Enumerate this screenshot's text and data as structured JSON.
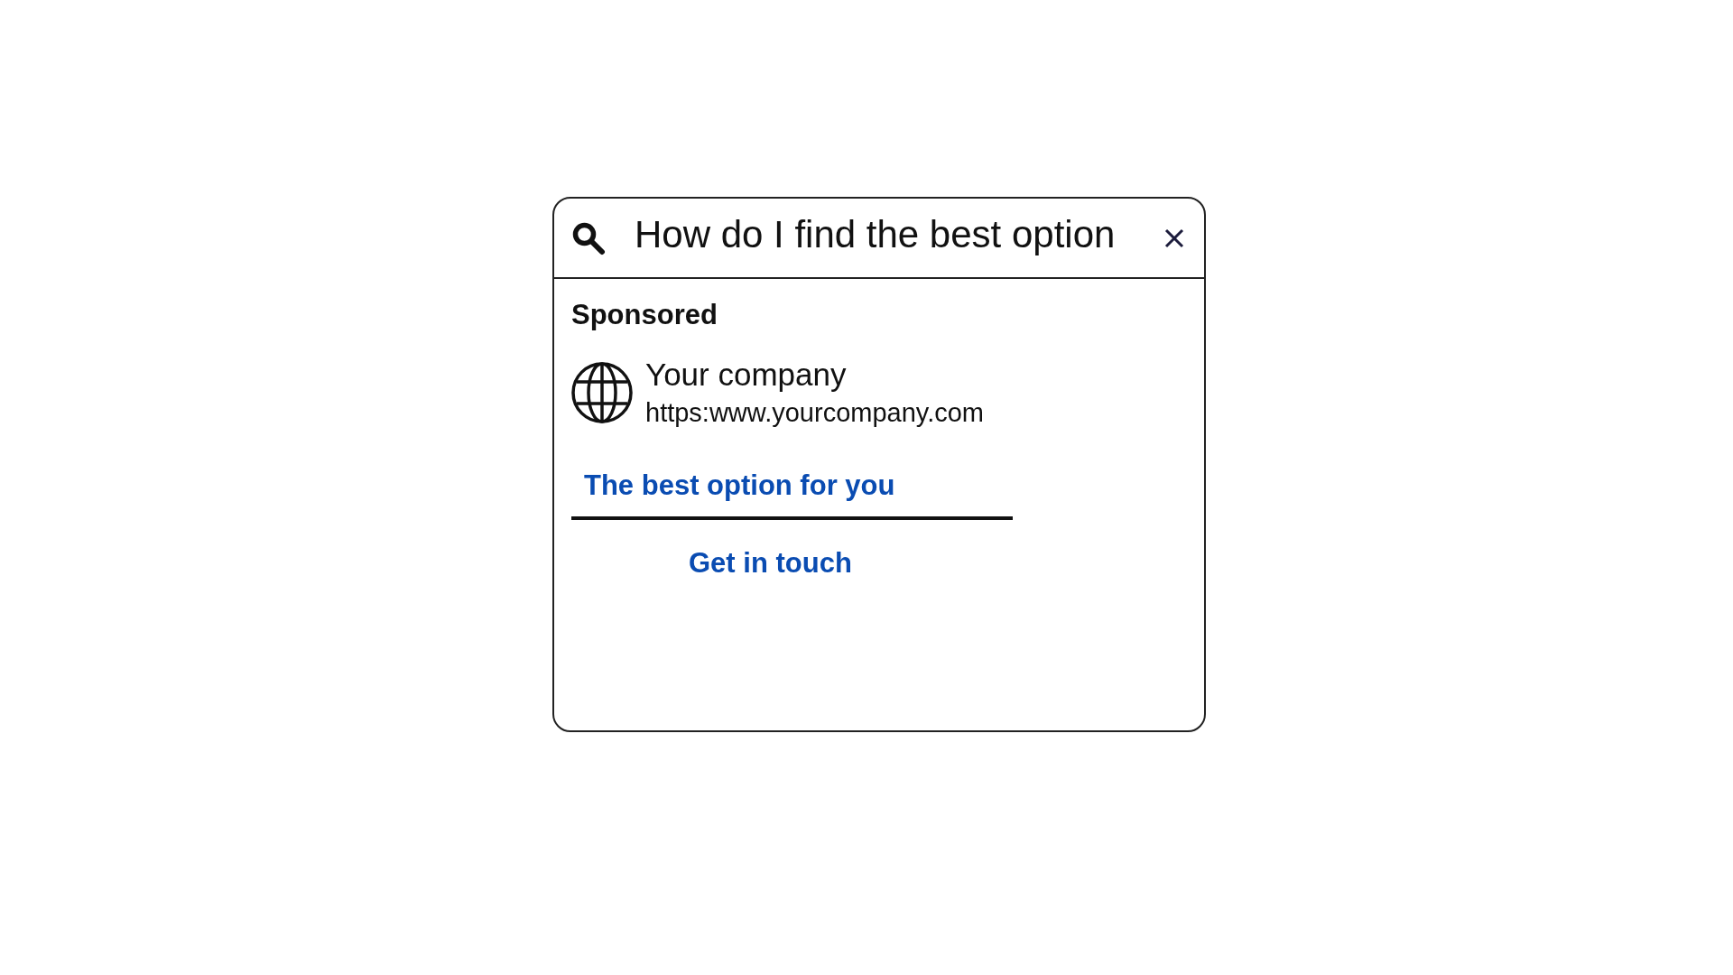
{
  "search": {
    "value": "How do I find the best option"
  },
  "result": {
    "label": "Sponsored",
    "advertiser": {
      "name": "Your company",
      "url": "https:www.yourcompany.com"
    },
    "headline": "The best option for you",
    "call_to_action": "Get in touch"
  }
}
